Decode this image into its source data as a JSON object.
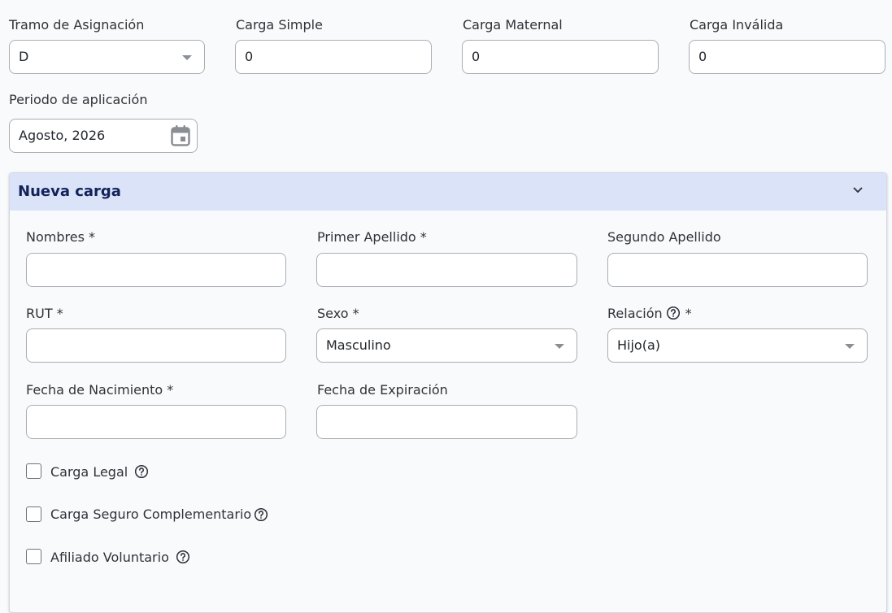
{
  "top_fields": {
    "tramo": {
      "label": "Tramo de Asignación",
      "value": "D"
    },
    "carga_simple": {
      "label": "Carga Simple",
      "value": "0"
    },
    "carga_maternal": {
      "label": "Carga Maternal",
      "value": "0"
    },
    "carga_invalida": {
      "label": "Carga Inválida",
      "value": "0"
    },
    "periodo": {
      "label": "Periodo de aplicación",
      "value": "Agosto, 2026"
    }
  },
  "panel": {
    "title": "Nueva carga",
    "fields": {
      "nombres": {
        "label": "Nombres *",
        "value": ""
      },
      "primer_apellido": {
        "label": "Primer Apellido *",
        "value": ""
      },
      "segundo_apellido": {
        "label": "Segundo Apellido",
        "value": ""
      },
      "rut": {
        "label": "RUT *",
        "value": ""
      },
      "sexo": {
        "label": "Sexo *",
        "value": "Masculino"
      },
      "relacion": {
        "label": "Relación",
        "required_mark": "*",
        "value": "Hijo(a)"
      },
      "fecha_nacimiento": {
        "label": "Fecha de Nacimiento *",
        "value": ""
      },
      "fecha_expiracion": {
        "label": "Fecha de Expiración",
        "value": ""
      }
    },
    "checkboxes": [
      {
        "label": "Carga Legal",
        "checked": false
      },
      {
        "label": "Carga Seguro Complementario",
        "checked": false
      },
      {
        "label": "Afiliado Voluntario",
        "checked": false
      }
    ]
  },
  "icons": {
    "calendar": "calendar-icon",
    "help": "help-circle-icon",
    "chevron": "chevron-down-icon",
    "dropdown": "dropdown-caret-icon"
  },
  "colors": {
    "panel_header_bg": "#dbe3f8",
    "panel_title": "#14225a",
    "border": "#a9aeb5"
  }
}
